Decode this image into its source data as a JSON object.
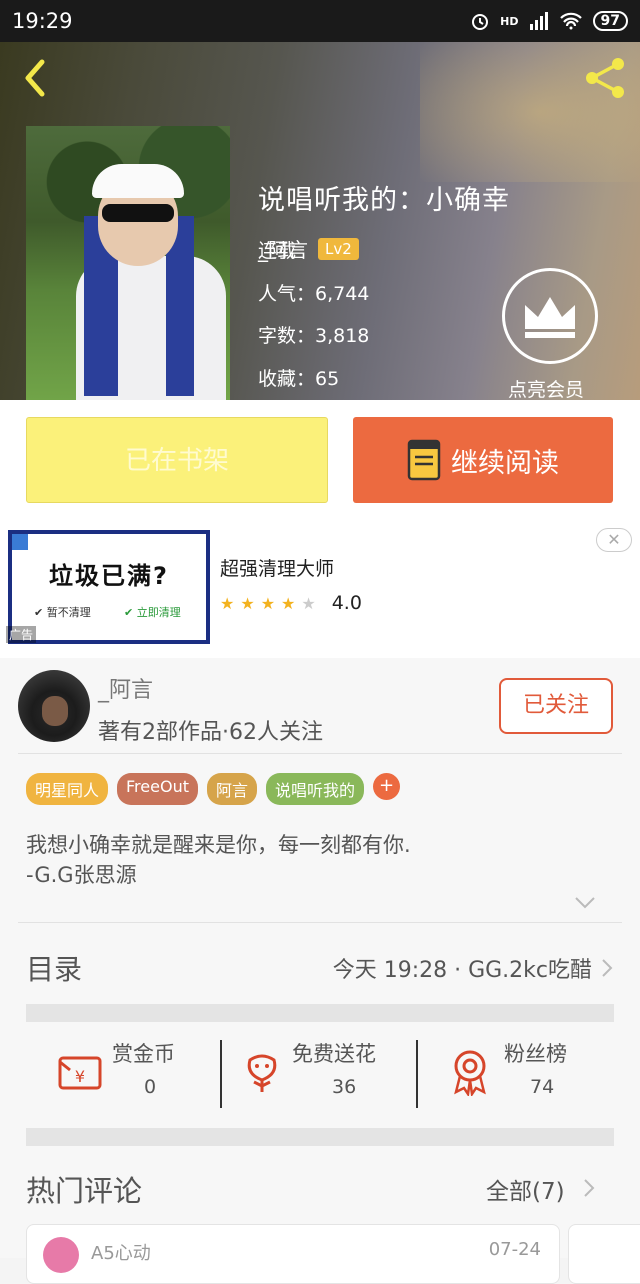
{
  "status_bar": {
    "time": "19:29",
    "network": "HD",
    "battery": "97"
  },
  "book": {
    "title": "说唱听我的：小确幸",
    "author": "_阿言",
    "level": "Lv2",
    "status": "连载",
    "popularity": "人气：6,744",
    "words": "字数：3,818",
    "favorites": "收藏：65",
    "vip_label": "点亮会员"
  },
  "actions": {
    "shelf_label": "已在书架",
    "read_label": "继续阅读"
  },
  "ad": {
    "headline": "垃圾已满?",
    "option_no": "暂不清理",
    "option_yes": "立即清理",
    "tag": "广告",
    "title": "超强清理大师",
    "rating": "4.0",
    "stars_on": 4
  },
  "author": {
    "name": "_阿言",
    "stats": "著有2部作品·62人关注",
    "follow_label": "已关注"
  },
  "tags": [
    {
      "label": "明星同人",
      "color": "#f0b440"
    },
    {
      "label": "FreeOut",
      "color": "#c8745a"
    },
    {
      "label": "阿言",
      "color": "#d6a44a"
    },
    {
      "label": "说唱听我的",
      "color": "#8ab85a"
    }
  ],
  "tag_add": "+",
  "description": {
    "line1": "我想小确幸就是醒来是你，每一刻都有你.",
    "line2": "-G.G张思源"
  },
  "toc": {
    "label": "目录",
    "latest": "今天 19:28 · GG.2kc吃醋"
  },
  "rewards": [
    {
      "label": "赏金币",
      "count": "0",
      "icon": "gold-coin-envelope-icon"
    },
    {
      "label": "免费送花",
      "count": "36",
      "icon": "flower-icon"
    },
    {
      "label": "粉丝榜",
      "count": "74",
      "icon": "rosette-medal-icon"
    }
  ],
  "comments": {
    "label": "热门评论",
    "all_label": "全部(7)",
    "first": {
      "user": "A5心动",
      "date": "07-24"
    }
  },
  "colors": {
    "accent": "#ec6a40",
    "shelf": "#fbf17a",
    "follow": "#e15a3a"
  }
}
